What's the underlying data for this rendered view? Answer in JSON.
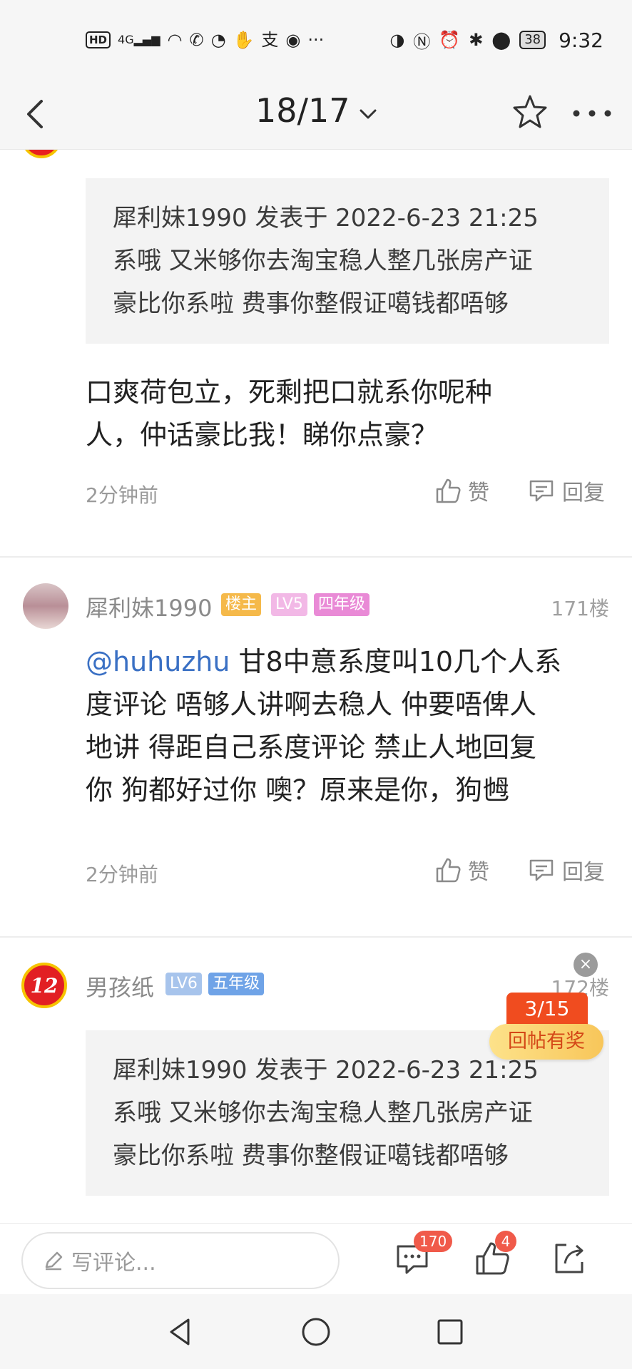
{
  "status_bar": {
    "left_badge": "HD",
    "network": "4G",
    "battery": "38",
    "time": "9:32",
    "more": "···"
  },
  "header": {
    "page_indicator": "18/17"
  },
  "posts": [
    {
      "quote": {
        "line1": "犀利妹1990 发表于 2022-6-23 21:25",
        "line2": "系哦 又米够你去淘宝稳人整几张房产证",
        "line3": "豪比你系啦 费事你整假证噶钱都唔够"
      },
      "text_line1": "口爽荷包立，死剩把口就系你呢种",
      "text_line2": "人，仲话豪比我！睇你点豪？",
      "time": "2分钟前",
      "like_label": "赞",
      "reply_label": "回复"
    },
    {
      "username": "犀利妹1990",
      "badges": [
        "楼主",
        "LV5",
        "四年级"
      ],
      "floor": "171楼",
      "mention": "@huhuzhu",
      "text_line1_rest": " 甘8中意系度叫10几个人系",
      "text_line2": "度评论 唔够人讲啊去稳人 仲要唔俾人",
      "text_line3": "地讲 得距自己系度评论 禁止人地回复",
      "text_line4": "你 狗都好过你 噢？原来是你，狗乸",
      "time": "2分钟前",
      "like_label": "赞",
      "reply_label": "回复"
    },
    {
      "username": "男孩纸",
      "avatar_text": "12",
      "badges": [
        "LV6",
        "五年级"
      ],
      "floor": "172楼",
      "quote": {
        "line1": "犀利妹1990 发表于 2022-6-23 21:25",
        "line2": "系哦 又米够你去淘宝稳人整几张房产证",
        "line3": "豪比你系啦 费事你整假证噶钱都唔够"
      }
    }
  ],
  "reward_popup": {
    "count": "3/15",
    "label": "回帖有奖",
    "close": "×"
  },
  "bottom_bar": {
    "input_placeholder": "写评论...",
    "comment_count": "170",
    "like_count": "4"
  },
  "colors": {
    "accent_orange": "#f04c1f",
    "mention_blue": "#3a70c4",
    "badge_red": "#f05a4a"
  }
}
